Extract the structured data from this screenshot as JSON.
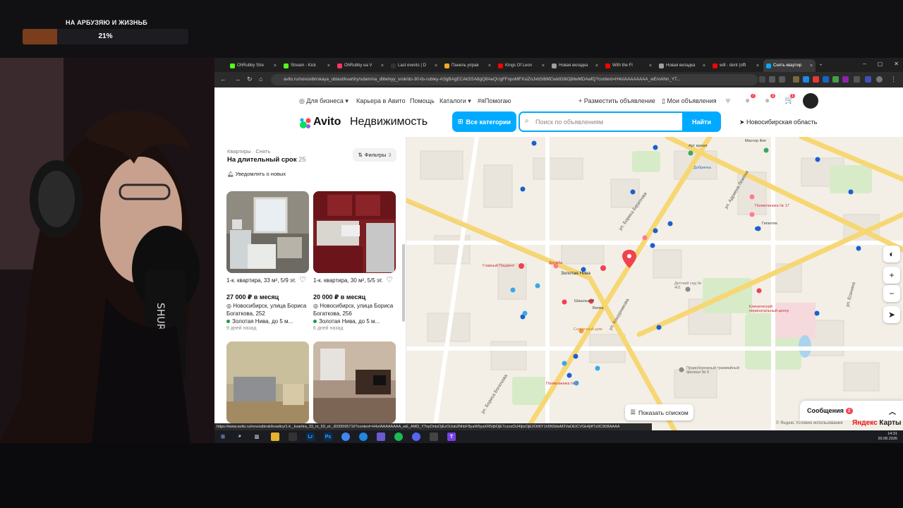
{
  "overlay": {
    "goal_title": "НА АРБУЗЯЮ И ЖИЗНЬБ",
    "goal_percent": "21%",
    "goal_progress": 0.21,
    "accent": "#7a3e1c"
  },
  "browser": {
    "tabs": [
      {
        "label": "OhRubby Stre",
        "icon": "kick-icon",
        "color": "#53fc18"
      },
      {
        "label": "Stream - Kick",
        "icon": "kick-icon",
        "color": "#53fc18"
      },
      {
        "label": "OhRubby на V",
        "icon": "vk-icon",
        "color": "#ff3366"
      },
      {
        "label": "Last events | D",
        "icon": "da-icon",
        "color": "#333333"
      },
      {
        "label": "Панель управ",
        "icon": "panel-icon",
        "color": "#f5a623"
      },
      {
        "label": "Kings Of Leon",
        "icon": "youtube-icon",
        "color": "#ff0000"
      },
      {
        "label": "Новая вкладка",
        "icon": "chrome-icon",
        "color": "#9aa0a6"
      },
      {
        "label": "With the Fl",
        "icon": "youtube-icon",
        "color": "#ff0000"
      },
      {
        "label": "Новая вкладка",
        "icon": "chrome-icon",
        "color": "#9aa0a6"
      },
      {
        "label": "wilt - dent (offi",
        "icon": "youtube-icon",
        "color": "#ff0000"
      },
      {
        "label": "Снять квартир",
        "icon": "avito-icon",
        "color": "#00aaff",
        "active": true
      }
    ],
    "url": "avito.ru/novosibirskaya_oblast/kvartiry/sdam/na_dlitelnyy_srok/do-30-tis-rubley-ASgBAgECAkSSA8gQ8AeQUgFFxpoMFXsiZnJvbSI6MCwidG8iOjMwMDAwfQ?context=H4sIAAAAAAAA_wEmANn_YT..."
  },
  "avito": {
    "topnav": {
      "business": "Для бизнеса",
      "career": "Карьера в Авито",
      "help": "Помощь",
      "catalogs": "Каталоги",
      "ipomogayu": "#яПомогаю",
      "post_ad": "Разместить объявление",
      "my_ads": "Мои объявления",
      "badges": {
        "notifications": "7",
        "messages": "2",
        "cart": "1"
      }
    },
    "logo": "Avito",
    "logo_section": "Недвижимость",
    "all_categories": "Все категории",
    "search": {
      "placeholder": "Поиск по объявлениям",
      "button": "Найти"
    },
    "region": "Новосибирская область"
  },
  "panel": {
    "crumb1": "Квартиры",
    "crumb2": "Снять",
    "title": "На длительный срок",
    "count": "25",
    "filters_label": "Фильтры",
    "filters_count": "3",
    "notify": "Уведомлять о новых",
    "listings": [
      {
        "title": "1-к. квартира, 33 м², 5/9 эт.",
        "price": "27 000 ₽ в месяц",
        "address": "Новосибирск, улица Бориса Богаткова, 252",
        "metro": "Золотая Нива, до 5 м...",
        "time": "9 дней назад"
      },
      {
        "title": "1-к. квартира, 30 м², 5/5 эт.",
        "price": "20 000 ₽ в месяц",
        "address": "Новосибирск, улица Бориса Богаткова, 256",
        "metro": "Золотая Нива, до 5 м...",
        "time": "6 дней назад"
      },
      {
        "title": "",
        "price": "",
        "address": "",
        "metro": "",
        "time": ""
      },
      {
        "title": "",
        "price": "",
        "address": "",
        "metro": "",
        "time": ""
      }
    ]
  },
  "map": {
    "show_list": "Показать списком",
    "messages": "Сообщения",
    "messages_count": "2",
    "copyright": "© Яндекс Условия использования",
    "yandex_logo_a": "Яндекс",
    "yandex_logo_b": "Карты",
    "labels": {
      "golden_niva": "Золотая Нива",
      "dobrinka": "Добринка",
      "polyclinic17": "Поликлиника № 17",
      "gigantik": "Гигантик",
      "main_patient": "Главный Пациент",
      "druzhba": "Дружба",
      "kids_garden": "Детский сад № 401",
      "clinic": "Клинический перинатальный центр",
      "sunny": "Солнечный дом",
      "legal": "Правобережный трамвайный филиал № 5",
      "polyclinic7": "Поликлиника № 7",
      "street_bogatkova": "ул. Бориса Богаткова",
      "street_kochubinova": "ул. Кошурникова",
      "street_lezhneva": "ул. Адриена Лежена",
      "street_esenina": "ул. Есенина",
      "master_fit": "Мастер Фит",
      "art_vremya": "Арт время",
      "shashlikoff": "Шашлыкоff",
      "berezka": "Вилка"
    }
  },
  "status_url": "https://www.avito.ru/novosibirsk/kvartiry/1-k._kvartira_33_m_59_et._8339595716?context=H4sIAAAAAAAA_wE_AMD_YToyOntzOjEzOiJsb2NhbF8yaW9yaXR5IjtiOjE7czoxOiJ4IjtzOjE2OiI6Y1h5N3dwM2VaOEICVGk4jIifTz0C9D8AAAA",
  "taskbar": {
    "time": "14:31",
    "date": "20.08.2026"
  },
  "colors": {
    "avito_blue": "#00aaff",
    "map_bg": "#f3efe6",
    "road_yellow": "#f7d774",
    "green": "#1a9b4a",
    "pin_red": "#f0424f"
  }
}
